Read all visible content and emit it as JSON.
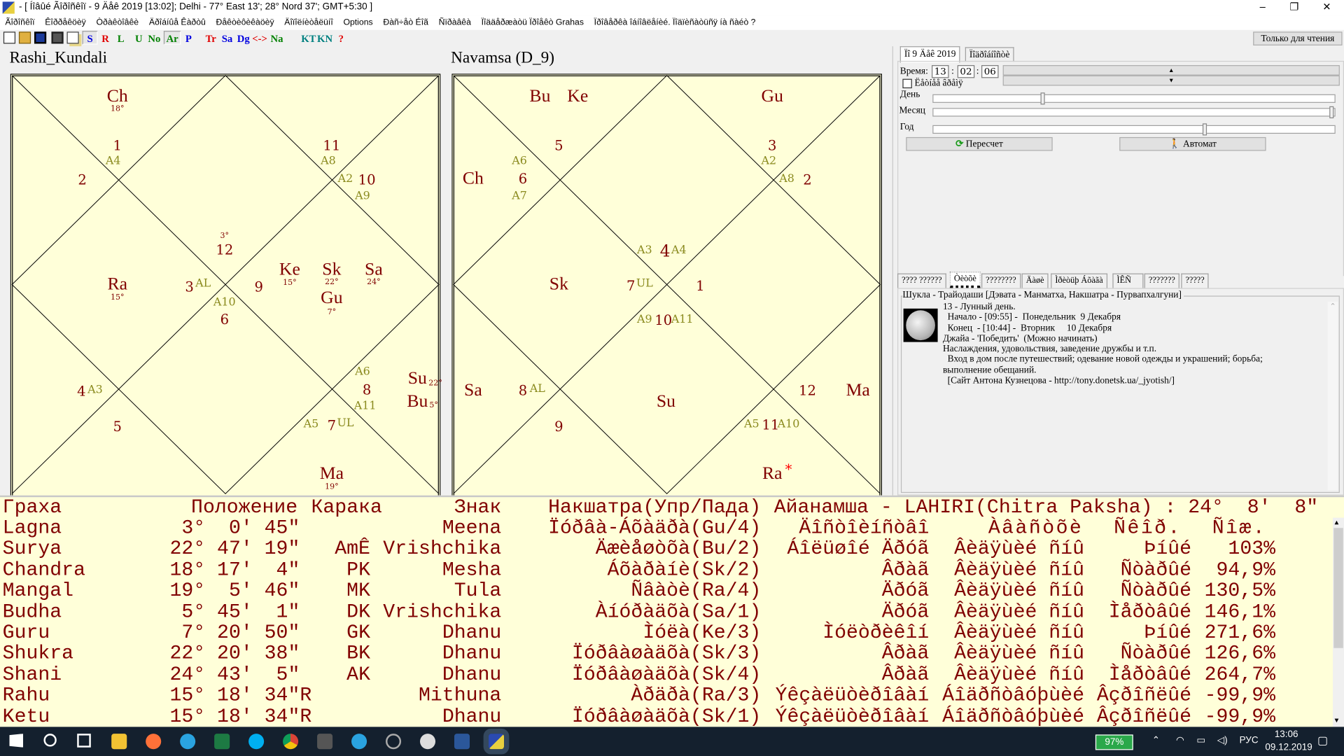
{
  "window": {
    "title": "- [ Íîâûé Ãîðîñêîï - 9 Äåê 2019 [13:02]; Delhi - 77° East 13'; 28° Nord 37'; GMT+5:30 ]",
    "controls": [
      "–",
      "❐",
      "✕"
    ]
  },
  "menu": [
    "Ãîðîñêîï",
    "Êîððåêöèÿ",
    "Òðàêòîâêè",
    "Äðîáíûå Êàðòû",
    "Ðåêòèôèêàöèÿ",
    "Äîïîëíèòåëüíî",
    "Options",
    "Ðàñ÷åò Éîã",
    "Ñïðàâêà",
    "Ïîääåðæàòü Ïðîåêò Grahas",
    "Ïðîâåðêà îáíîâëåíèé. Ïîäïèñàòüñÿ íà ñàéò ?"
  ],
  "toolbar": {
    "icons": [
      "new-document",
      "open-folder",
      "save",
      "print",
      "copy"
    ],
    "buttons": [
      "S",
      "R",
      "L",
      "U",
      "No",
      "Ar",
      "P",
      "Tr",
      "Sa",
      "Dg",
      "<->",
      "Na",
      "KT",
      "KN",
      "?"
    ],
    "pressed": "Ar",
    "readonly_label": "Только для чтения"
  },
  "rashi": {
    "title": "Rashi_Kundali",
    "labels": [
      "Ch",
      "18°",
      "1",
      "A4",
      "11",
      "A8",
      "2",
      "A2",
      "10",
      "A9",
      "3°",
      "12",
      "Ra",
      "15°",
      "3",
      "AL",
      "9",
      "Ke",
      "15°",
      "Sk",
      "22°",
      "Sa",
      "24°",
      "Gu",
      "7°",
      "A10",
      "6",
      "4",
      "A3",
      "A6",
      "8",
      "A11",
      "Su",
      "22°",
      "Bu",
      "5°",
      "5",
      "A5",
      "7",
      "UL",
      "Ma",
      "19°"
    ]
  },
  "navamsa": {
    "title": "Navamsa (D_9)",
    "labels": [
      "Bu",
      "Ke",
      "Gu",
      "5",
      "3",
      "A2",
      "A6",
      "Ch",
      "6",
      "A7",
      "A8",
      "2",
      "A3",
      "4",
      "A4",
      "Sk",
      "7",
      "UL",
      "1",
      "A9",
      "10",
      "A11",
      "Sa",
      "8",
      "AL",
      "Su",
      "12",
      "Ma",
      "9",
      "A5",
      "11",
      "A10",
      "Ra",
      "*"
    ]
  },
  "chart_colors": {
    "background": "#ffffd9",
    "planet": "#800000",
    "arudha": "#8a8a1e",
    "retro_mark": "#ff0000"
  },
  "right_panel": {
    "tabs": [
      "Ïî 9 Äåê 2019",
      "Ïîäðîáíîñòè"
    ],
    "time_label": "Время:",
    "time": {
      "h": "13",
      "m": "02",
      "s": "06"
    },
    "time_sep": ":",
    "checkbox_label": "Ëåòíåå âðåìÿ",
    "checkbox_checked": false,
    "sliders": [
      {
        "label": "День",
        "value_fraction": 0.27
      },
      {
        "label": "Месяц",
        "value_fraction": 1.0
      },
      {
        "label": "Год",
        "value_fraction": 0.68
      }
    ],
    "recalc_button": "Пересчет",
    "auto_button": "Автомат",
    "info_tabs": [
      "???? ??????",
      "Òèòõè",
      "????????",
      "Äàøè",
      "Ìðèòüþ Áõàãà",
      "ÌÊÑ",
      "???????",
      "?????"
    ],
    "active_info_tab": "Òèòõè",
    "group_title": "Шукла - Трайодаши [Дэвата - Манматха, Накшатра - Пурвапхалгуни]",
    "lines": [
      "13 - Лунный день.",
      "  Начало - [09:55] -  Понедельник  9 Декабря",
      "  Конец  - [10:44] -  Вторник     10 Декабря",
      "Джайа - 'Победить'  (Можно начинать)",
      "Наслаждения, удовольствия, заведение дружбы и т.п.",
      "  Вход в дом после путешествий; одевание новой одежды и украшений; борьба;",
      "выполнение обещаний.",
      "  [Сайт Антона Кузнецова - http://tony.donetsk.ua/_jyotish/]"
    ]
  },
  "table": {
    "header": {
      "graha": "Граха",
      "position": "Положение",
      "karaka": "Карака",
      "sign": "Знак",
      "nakshatra": "Накшатра(Упр/Пада)",
      "ayanamsha": "Айанамша - LAHIRI(Chitra Paksha) : 24°  8'  8\""
    },
    "rows": [
      {
        "graha": "Lagna",
        "position": " 3°  0' 45\"",
        "karaka": "",
        "sign": "Meena",
        "nakshatra": "Ïóðâà-Áõàäðà(Gu/4)",
        "dignity": "Äîñòîèíñòâî",
        "relation": "",
        "state": "",
        "percent": "",
        "tail": "Àâàñòõè Ñêîð. Ñîæ."
      },
      {
        "graha": "Surya",
        "position": "22° 47' 19\"",
        "karaka": "AmÊ",
        "sign": "Vrishchika",
        "nakshatra": "Äæèåøòõà(Bu/2)",
        "dignity": "Áîëüøîé Äðóã",
        "relation": "Âèäÿùèé ñíû",
        "state": "Þíûé",
        "percent": "103%"
      },
      {
        "graha": "Chandra",
        "position": "18° 17'  4\"",
        "karaka": "PK",
        "sign": "Mesha",
        "nakshatra": "Áõàðàíè(Sk/2)",
        "dignity": "Âðàã",
        "relation": "Âèäÿùèé ñíû",
        "state": "Ñòàðûé",
        "percent": "94,9%"
      },
      {
        "graha": "Mangal",
        "position": "19°  5' 46\"",
        "karaka": "MK",
        "sign": "Tula",
        "nakshatra": "Ñâàòè(Ra/4)",
        "dignity": "Äðóã",
        "relation": "Âèäÿùèé ñíû",
        "state": "Ñòàðûé",
        "percent": "130,5%"
      },
      {
        "graha": "Budha",
        "position": " 5° 45'  1\"",
        "karaka": "DK",
        "sign": "Vrishchika",
        "nakshatra": "Àíóðàäõà(Sa/1)",
        "dignity": "Äðóã",
        "relation": "Âèäÿùèé ñíû",
        "state": "Ìåðòâûé",
        "percent": "146,1%"
      },
      {
        "graha": "Guru",
        "position": " 7° 20' 50\"",
        "karaka": "GK",
        "sign": "Dhanu",
        "nakshatra": "Ìóëà(Ke/3)",
        "dignity": "Ìóëòðèêîí",
        "relation": "Âèäÿùèé ñíû",
        "state": "Þíûé",
        "percent": "271,6%"
      },
      {
        "graha": "Shukra",
        "position": "22° 20' 38\"",
        "karaka": "BK",
        "sign": "Dhanu",
        "nakshatra": "Ïóðâàøàäõà(Sk/3)",
        "dignity": "Âðàã",
        "relation": "Âèäÿùèé ñíû",
        "state": "Ñòàðûé",
        "percent": "126,6%"
      },
      {
        "graha": "Shani",
        "position": "24° 43'  5\"",
        "karaka": "AK",
        "sign": "Dhanu",
        "nakshatra": "Ïóðâàøàäõà(Sk/4)",
        "dignity": "Âðàã",
        "relation": "Âèäÿùèé ñíû",
        "state": "Ìåðòâûé",
        "percent": "264,7%"
      },
      {
        "graha": "Rahu",
        "position": "15° 18' 34\"R",
        "karaka": "",
        "sign": "Mithuna",
        "nakshatra": "Àðäðà(Ra/3)",
        "dignity": "Ýêçàëüòèðîâàí",
        "relation": "Áîäðñòâóþùèé",
        "state": "Âçðîñëûé",
        "percent": "-99,9%"
      },
      {
        "graha": "Ketu",
        "position": "15° 18' 34\"R",
        "karaka": "",
        "sign": "Dhanu",
        "nakshatra": "Ïóðâàøàäõà(Sk/1)",
        "dignity": "Ýêçàëüòèðîâàí",
        "relation": "Áîäðñòâóþùèé",
        "state": "Âçðîñëûé",
        "percent": "-99,9%"
      }
    ]
  },
  "taskbar": {
    "apps": [
      "start",
      "search",
      "task-view",
      "file-explorer",
      "firefox",
      "telegram",
      "excel",
      "skype",
      "chrome",
      "calculator",
      "telegram-2",
      "app-circle",
      "app-paint",
      "word",
      "grahas"
    ],
    "battery": "97%",
    "language": "РУС",
    "time": "13:06",
    "date": "09.12.2019"
  }
}
